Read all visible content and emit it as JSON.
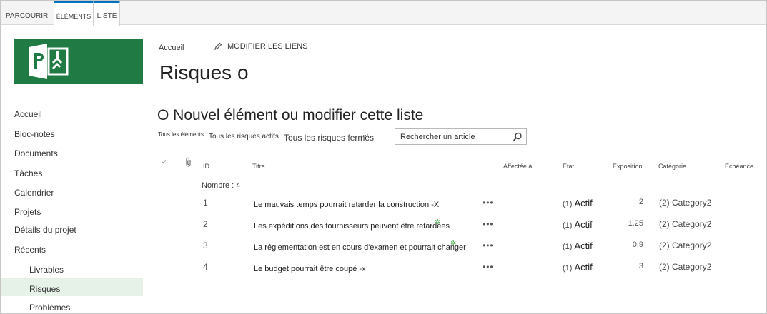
{
  "ribbon": {
    "tabs": [
      {
        "label": "PARCOURIR"
      },
      {
        "label": "ÉLÉMENTS"
      },
      {
        "label": "LISTE"
      }
    ]
  },
  "nav": {
    "items": [
      "Accueil",
      "Bloc-notes",
      "Documents",
      "Tâches",
      "Calendrier",
      "Projets",
      "Détails du projet",
      "Récents"
    ],
    "sub_items": [
      "Livrables",
      "Risques",
      "Problèmes"
    ],
    "selected": "Risques"
  },
  "breadcrumb": {
    "home": "Accueil",
    "edit_links": "MODIFIER LES LIENS"
  },
  "page": {
    "title": "Risques o",
    "subtitle": "O Nouvel élément ou modifier cette liste"
  },
  "views": {
    "all": "Tous les éléments",
    "active": "Tous les risques actifs",
    "closed": "Tous les risques fermés",
    "more": "..."
  },
  "search": {
    "placeholder": "Rechercher un article"
  },
  "table": {
    "headers": {
      "check": "✓",
      "id": "ID",
      "title": "Titre",
      "assigned": "Affectée à",
      "state": "État",
      "exposure": "Exposition",
      "category": "Catégorie",
      "due": "Échéance"
    },
    "group_label": "Nombre : 4",
    "rows": [
      {
        "id": "1",
        "title": "Le mauvais temps pourrait retarder la construction -X",
        "menu": "•••",
        "state_prefix": "(1)",
        "state": "Actif",
        "exposure": "2",
        "category": "(2) Category2"
      },
      {
        "id": "2",
        "title": "Les expéditions des fournisseurs peuvent être retardées",
        "menu": "•••",
        "state_prefix": "(1)",
        "state": "Actif",
        "exposure": "1.25",
        "category": "(2) Category2"
      },
      {
        "id": "3",
        "title": "La réglementation est en cours d'examen et pourrait changer",
        "menu": "•••",
        "state_prefix": "(1)",
        "state": "Actif",
        "exposure": "0.9",
        "category": "(2) Category2"
      },
      {
        "id": "4",
        "title": "Le budget pourrait être coupé -x",
        "menu": "•••",
        "state_prefix": "(1)",
        "state": "Actif",
        "exposure": "3",
        "category": "(2) Category2"
      }
    ],
    "new_marker": "✲"
  },
  "colors": {
    "logo": "#1f7a43",
    "tab_accent": "#0072c6",
    "nav_selected": "#e6f2e8"
  }
}
